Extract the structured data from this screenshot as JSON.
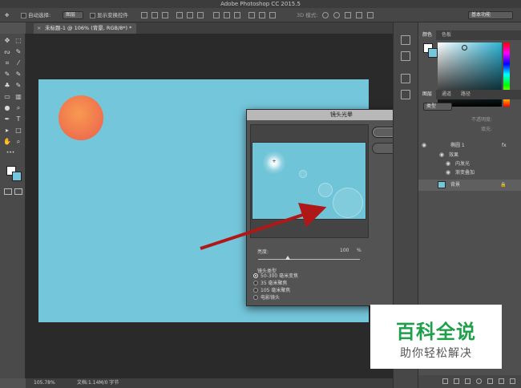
{
  "window": {
    "title": "Adobe Photoshop CC 2015.5"
  },
  "options_bar": {
    "auto_select_label": "自动选择:",
    "auto_select_value": "图层",
    "show_transform_label": "显示变换控件",
    "mode_3d_label": "3D 模式:",
    "workspace_value": "基本功能"
  },
  "document_tab": {
    "close_glyph": "×",
    "label": "未标题-1 @ 106% (背景, RGB/8*) *"
  },
  "status_bar": {
    "zoom": "105.78%",
    "doc_info": "文档:1.14M/0 字节"
  },
  "dialog": {
    "title": "镜头光晕",
    "ok_label": "确定",
    "default_label": "默认",
    "brightness_label": "亮度:",
    "brightness_value": "100",
    "brightness_unit": "%",
    "brightness": 100,
    "lens_type_label": "镜头类型",
    "lens_options": [
      "50-300 毫米变焦",
      "35 毫米聚焦",
      "105 毫米聚焦",
      "电影镜头"
    ],
    "selected_lens_index": 0
  },
  "color_panel": {
    "tabs": [
      "颜色",
      "色板"
    ]
  },
  "layers_panel": {
    "tabs": [
      "图层",
      "通道",
      "路径"
    ],
    "kind_filter": "类型",
    "opacity_label": "不透明度:",
    "fill_label": "填充:",
    "fx_glyph": "fx",
    "layers": [
      {
        "name": "椭圆 1"
      },
      {
        "name": "效果"
      },
      {
        "name": "内发光"
      },
      {
        "name": "渐变叠加"
      },
      {
        "name": "背景"
      }
    ]
  },
  "watermark": {
    "title": "百科全说",
    "subtitle": "助你轻松解决"
  },
  "colors": {
    "canvas": "#74c6db",
    "sun_start": "#f79a50",
    "sun_end": "#ec5e4d",
    "arrow": "#b01818",
    "watermark_green": "#1f9f4a"
  },
  "icons": {
    "move_tool": "✥",
    "marquee_tool": "⬚",
    "lasso_tool": "ᔓ",
    "crop_tool": "⌗",
    "eyedropper_tool": "⁄",
    "brush_tool": "✎",
    "stamp_tool": "♣",
    "eraser_tool": "▭",
    "gradient_tool": "▥",
    "dodge_tool": "●",
    "pen_tool": "✒",
    "type_tool": "T",
    "path_select_tool": "▸",
    "shape_tool": "□",
    "hand_tool": "✋",
    "zoom_tool": "⌕",
    "more_tools": "•••",
    "eye": "◉",
    "lock": "🔒",
    "flare_cross": "+"
  }
}
